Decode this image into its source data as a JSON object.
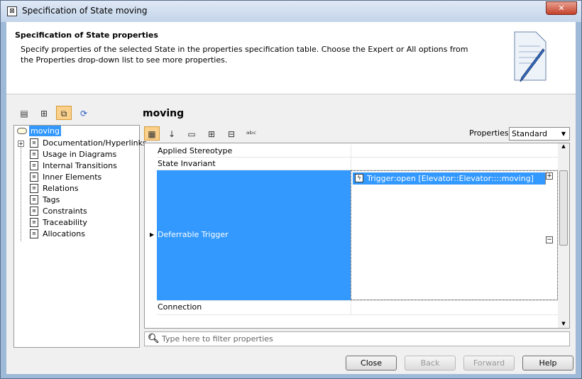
{
  "window": {
    "title": "Specification of State moving",
    "close": "✕"
  },
  "header": {
    "title": "Specification of State properties",
    "description": "Specify properties of the selected State in the properties specification table. Choose the Expert or All options from the Properties drop-down list to see more properties."
  },
  "tree": {
    "root": "moving",
    "items": [
      "Documentation/Hyperlinks",
      "Usage in Diagrams",
      "Internal Transitions",
      "Inner Elements",
      "Relations",
      "Tags",
      "Constraints",
      "Traceability",
      "Allocations"
    ]
  },
  "element_name": "moving",
  "properties": {
    "label": "Properties:",
    "selected": "Standard"
  },
  "grid": {
    "rows": [
      {
        "name": "Applied Stereotype",
        "value": ""
      },
      {
        "name": "State Invariant",
        "value": ""
      },
      {
        "name": "Deferrable Trigger",
        "value": "Trigger:open [Elevator::Elevator::::moving]"
      },
      {
        "name": "Connection",
        "value": ""
      }
    ]
  },
  "filter": {
    "placeholder": "Type here to filter properties"
  },
  "buttons": {
    "close": "Close",
    "back": "Back",
    "forward": "Forward",
    "help": "Help"
  }
}
